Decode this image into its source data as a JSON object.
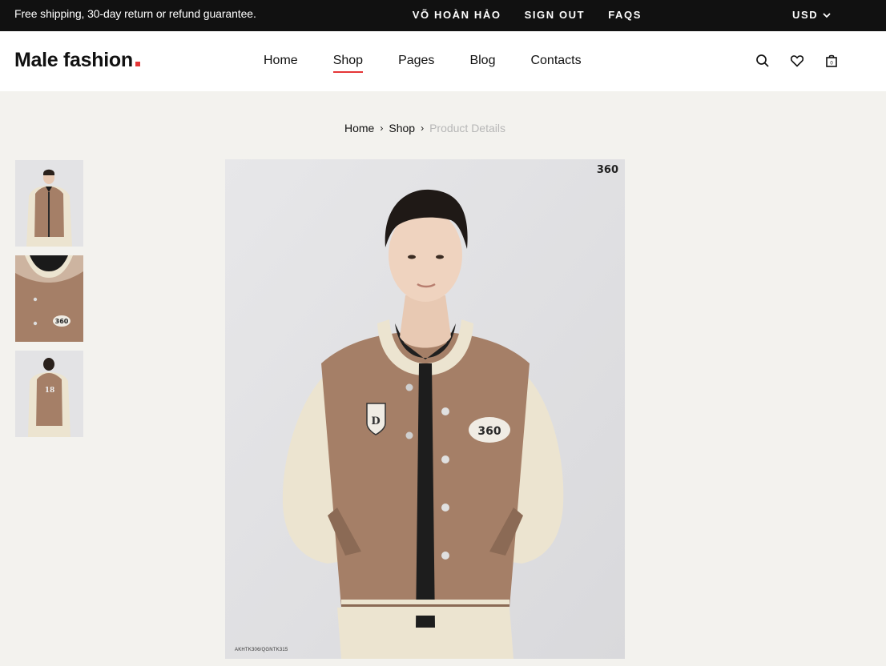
{
  "topbar": {
    "promo": "Free shipping, 30-day return or refund guarantee.",
    "user_name": "VÕ HOÀN HẢO",
    "sign_out": "SIGN OUT",
    "faqs": "FAQS",
    "currency": "USD"
  },
  "header": {
    "logo": "Male fashion",
    "nav": [
      "Home",
      "Shop",
      "Pages",
      "Blog",
      "Contacts"
    ],
    "active_nav": "Shop",
    "icons": [
      "search-icon",
      "heart-icon",
      "bag-icon"
    ]
  },
  "breadcrumb": {
    "home": "Home",
    "shop": "Shop",
    "current": "Product Details"
  },
  "product": {
    "image_code": "AKHTK306/QGNTK315",
    "brand_mark": "360",
    "thumbnails": [
      "front view",
      "detail view",
      "back view"
    ]
  },
  "colors": {
    "accent": "#e53637",
    "topbar": "#111111",
    "page_bg": "#f3f2ee",
    "jacket_body": "#a57f67",
    "jacket_sleeve": "#ece4d0"
  }
}
